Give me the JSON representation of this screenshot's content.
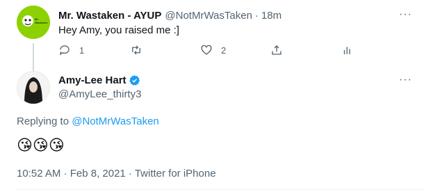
{
  "reply_tweet": {
    "display_name": "Mr. Wastaken - AYUP",
    "handle": "@NotMrWasTaken",
    "separator": "·",
    "time_ago": "18m",
    "text": "Hey Amy, you raised me :]",
    "avatar_text": "Mr. Wastaken",
    "actions": {
      "reply_count": "1",
      "retweet_count": "",
      "like_count": "2"
    }
  },
  "main_tweet": {
    "display_name": "Amy-Lee Hart",
    "handle": "@AmyLee_thirty3",
    "replying_to_label": "Replying to",
    "replying_to_handle": "@NotMrWasTaken",
    "emojis": "😘😘😘",
    "timestamp": "10:52 AM · Feb 8, 2021 · Twitter for iPhone"
  },
  "more_label": "···",
  "colors": {
    "accent": "#1d9bf0",
    "avatar_bg": "#8dd200",
    "muted_text": "#536471"
  }
}
